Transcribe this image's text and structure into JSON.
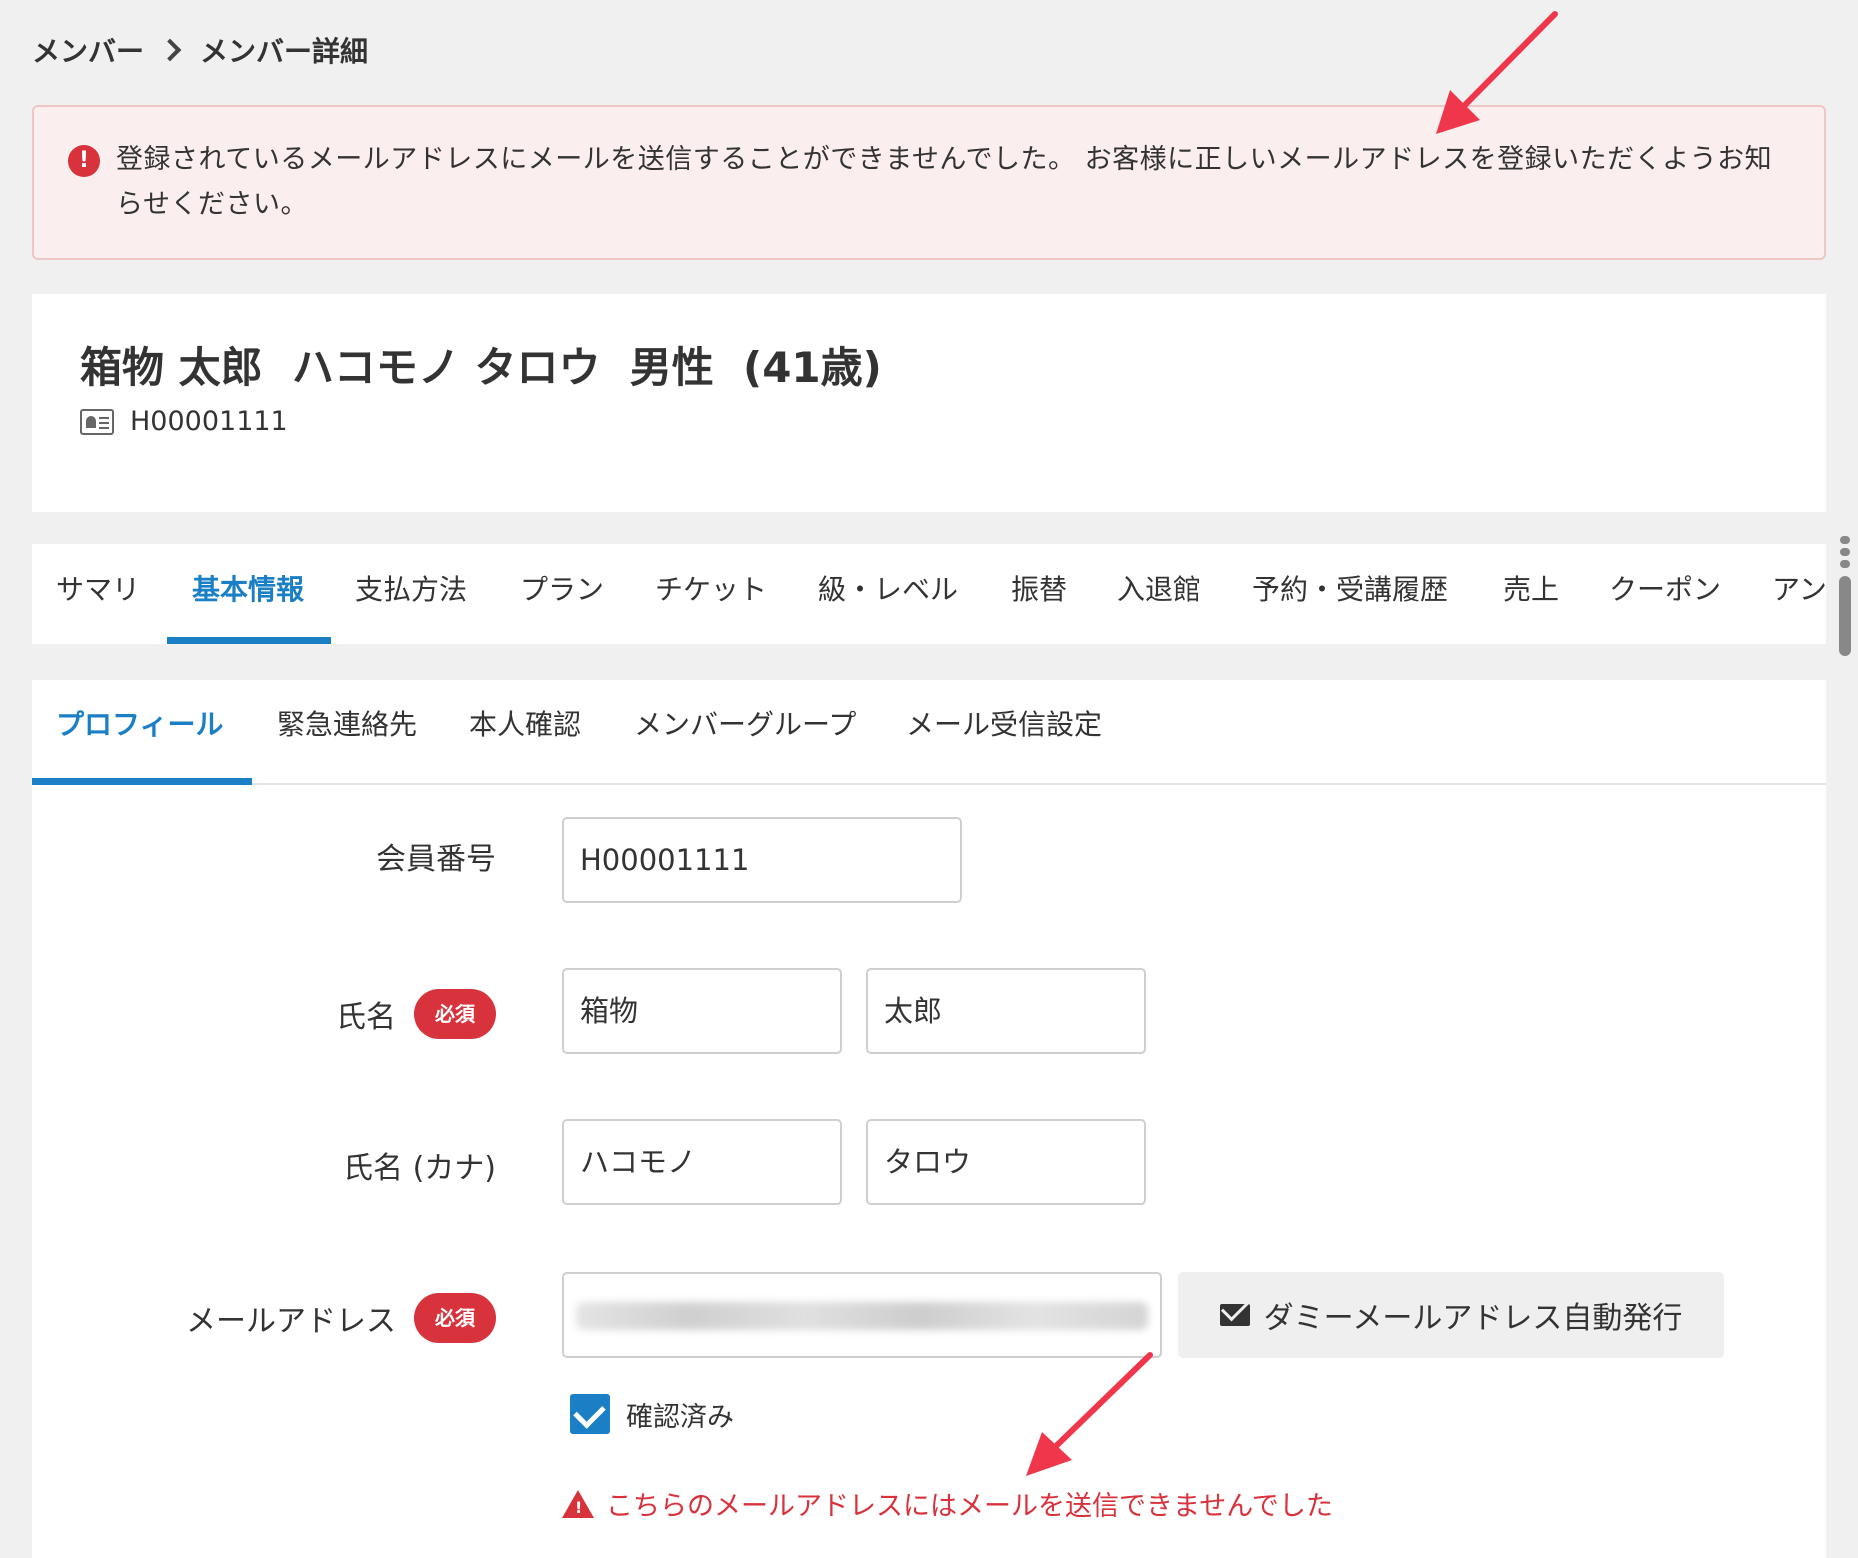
{
  "breadcrumb": {
    "parent": "メンバー",
    "current": "メンバー詳細"
  },
  "alert": {
    "icon": "exclamation-circle-icon",
    "message": "登録されているメールアドレスにメールを送信することができませんでした。 お客様に正しいメールアドレスを登録いただくようお知らせください。"
  },
  "member": {
    "name": "箱物 太郎",
    "kana": "ハコモノ タロウ",
    "gender": "男性",
    "age": "(41歳)",
    "id": "H00001111"
  },
  "main_tabs": [
    {
      "label": "サマリ",
      "active": false
    },
    {
      "label": "基本情報",
      "active": true
    },
    {
      "label": "支払方法",
      "active": false
    },
    {
      "label": "プラン",
      "active": false
    },
    {
      "label": "チケット",
      "active": false
    },
    {
      "label": "級・レベル",
      "active": false
    },
    {
      "label": "振替",
      "active": false
    },
    {
      "label": "入退館",
      "active": false
    },
    {
      "label": "予約・受講履歴",
      "active": false
    },
    {
      "label": "売上",
      "active": false
    },
    {
      "label": "クーポン",
      "active": false
    },
    {
      "label": "アン",
      "active": false
    }
  ],
  "sub_tabs": [
    {
      "label": "プロフィール",
      "active": true
    },
    {
      "label": "緊急連絡先",
      "active": false
    },
    {
      "label": "本人確認",
      "active": false
    },
    {
      "label": "メンバーグループ",
      "active": false
    },
    {
      "label": "メール受信設定",
      "active": false
    }
  ],
  "form": {
    "member_number": {
      "label": "会員番号",
      "value": "H00001111"
    },
    "name": {
      "label": "氏名",
      "required": "必須",
      "last": "箱物",
      "first": "太郎"
    },
    "name_kana": {
      "label": "氏名 (カナ)",
      "last": "ハコモノ",
      "first": "タロウ"
    },
    "email": {
      "label": "メールアドレス",
      "required": "必須",
      "value_blurred": true
    },
    "dummy_button": "ダミーメールアドレス自動発行",
    "verified_label": "確認済み",
    "verified_checked": true,
    "warning": "こちらのメールアドレスにはメールを送信できませんでした"
  },
  "colors": {
    "accent": "#1a7fc4",
    "danger": "#d8323c",
    "alert_bg": "#fbeeee",
    "annotation_arrow": "#f0364a"
  }
}
